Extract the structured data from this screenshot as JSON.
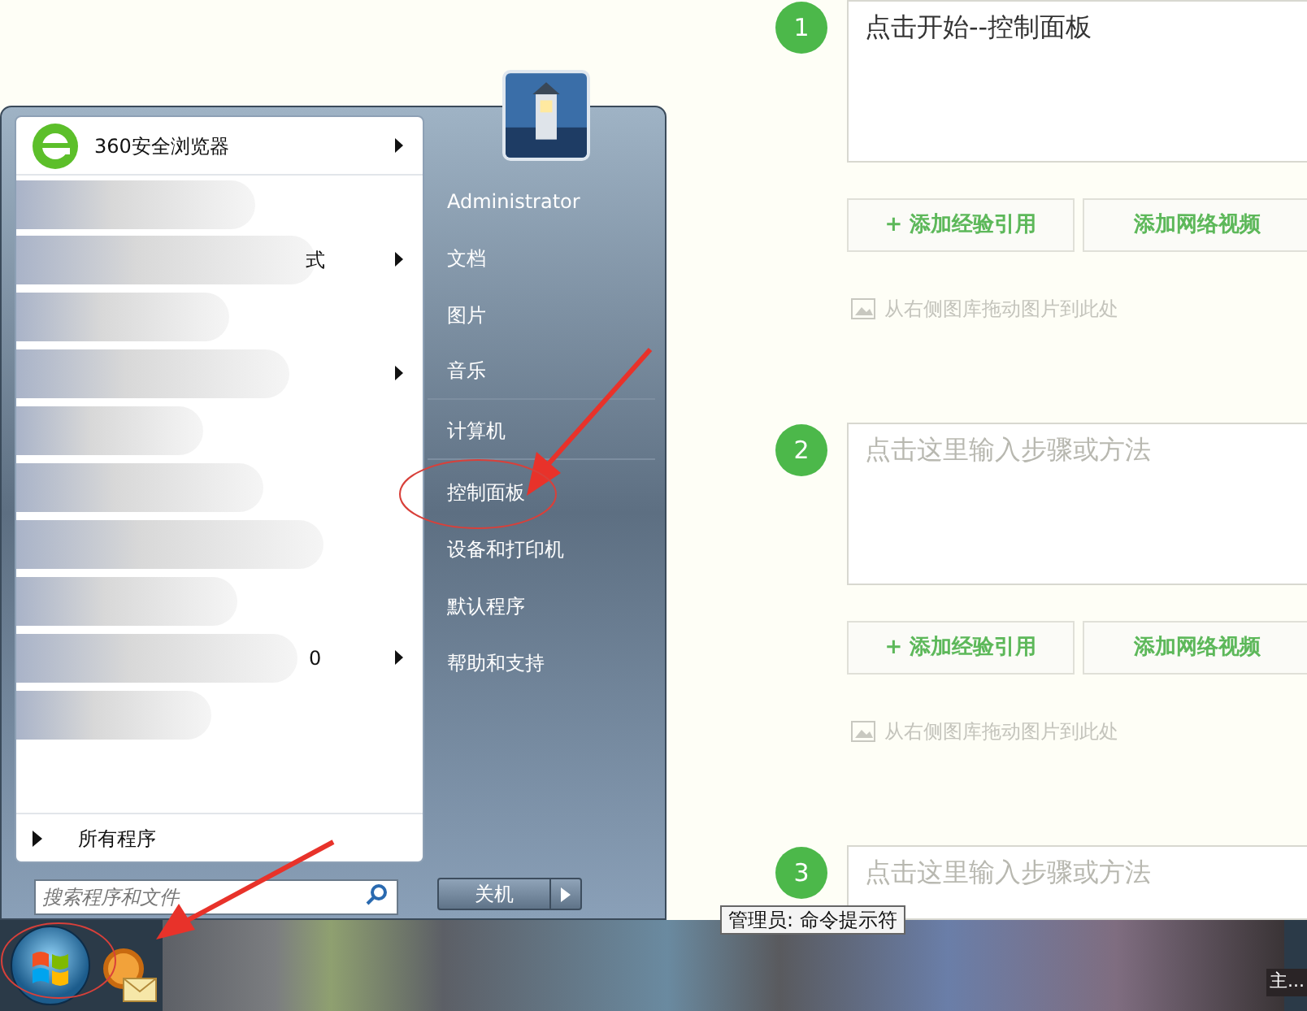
{
  "editor": {
    "steps": [
      {
        "number": "1",
        "text": "点击开始--控制面板",
        "buttons": [
          "+ 添加经验引用",
          "添加网络视频"
        ],
        "hint": "从右侧图库拖动图片到此处"
      },
      {
        "number": "2",
        "placeholder": "点击这里输入步骤或方法",
        "buttons": [
          "+ 添加经验引用",
          "添加网络视频"
        ],
        "hint": "从右侧图库拖动图片到此处"
      },
      {
        "number": "3",
        "placeholder": "点击这里输入步骤或方法"
      }
    ]
  },
  "start_menu": {
    "pinned": [
      {
        "kind": "app",
        "label": "360安全浏览器",
        "submenu": true
      },
      {
        "kind": "blurred",
        "submenu": false
      },
      {
        "kind": "blurred",
        "fragment": "式",
        "submenu": true
      },
      {
        "kind": "blurred",
        "submenu": false
      },
      {
        "kind": "blurred",
        "submenu": true
      },
      {
        "kind": "blurred",
        "submenu": false
      },
      {
        "kind": "blurred",
        "submenu": false
      },
      {
        "kind": "blurred",
        "submenu": false
      },
      {
        "kind": "blurred",
        "submenu": false
      },
      {
        "kind": "blurred",
        "fragment": "0",
        "submenu": true
      },
      {
        "kind": "blurred",
        "submenu": false
      }
    ],
    "all_programs": "所有程序",
    "search": {
      "placeholder": "搜索程序和文件"
    },
    "user": "Administrator",
    "places": [
      {
        "label": "文档",
        "separator_after": false
      },
      {
        "label": "图片",
        "separator_after": false
      },
      {
        "label": "音乐",
        "separator_after": true
      },
      {
        "label": "计算机",
        "separator_after": true
      },
      {
        "label": "控制面板",
        "separator_after": false
      },
      {
        "label": "设备和打印机",
        "separator_after": false
      },
      {
        "label": "默认程序",
        "separator_after": false
      },
      {
        "label": "帮助和支持",
        "separator_after": false
      }
    ],
    "shutdown": "关机"
  },
  "tooltip": "管理员: 命令提示符",
  "taskbar": {
    "overflow_label": "主..."
  }
}
